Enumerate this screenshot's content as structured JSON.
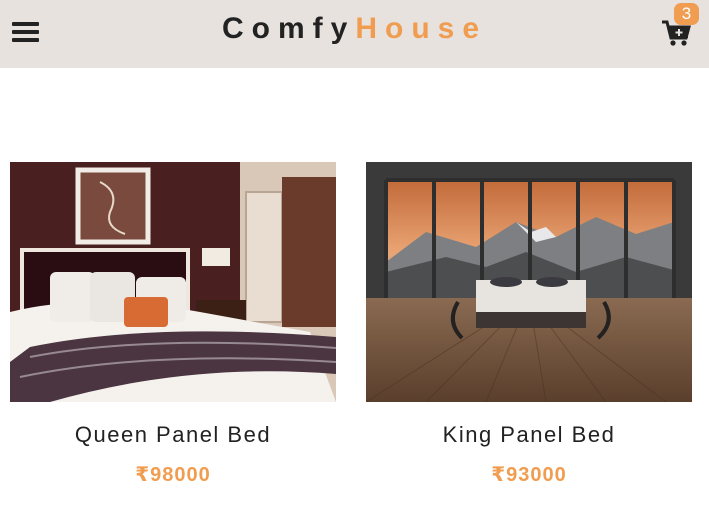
{
  "brand": {
    "part1": "Comfy",
    "part2": "House",
    "accent": "#f09d51"
  },
  "nav": {
    "menu_icon": "hamburger-menu-icon",
    "cart_icon": "cart-icon",
    "cart_count": "3"
  },
  "products": [
    {
      "title": "Queen Panel Bed",
      "price": "₹98000",
      "image": "bedroom-photo"
    },
    {
      "title": "King Panel Bed",
      "price": "₹93000",
      "image": "mountain-view-bed-photo"
    }
  ]
}
